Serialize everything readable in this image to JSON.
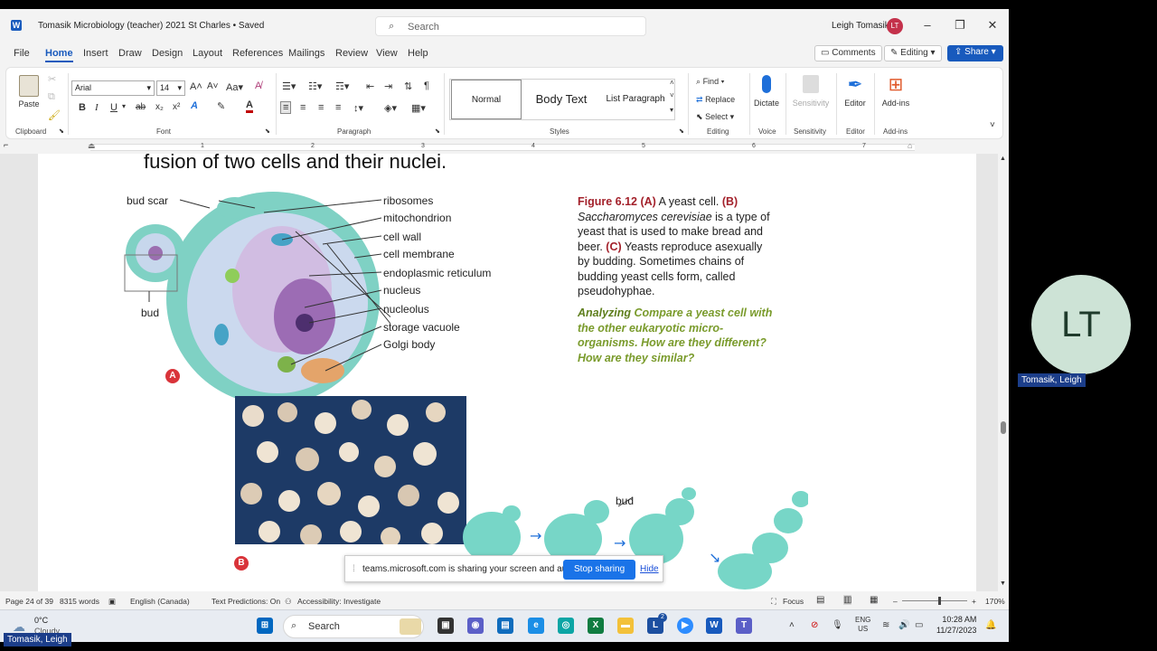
{
  "window": {
    "title": "Tomasik Microbiology (teacher) 2021 St Charles • Saved",
    "search_placeholder": "Search",
    "user_name": "Leigh Tomasik",
    "user_initials": "LT"
  },
  "menu": {
    "tabs": [
      "File",
      "Home",
      "Insert",
      "Draw",
      "Design",
      "Layout",
      "References",
      "Mailings",
      "Review",
      "View",
      "Help"
    ],
    "active_tab": "Home",
    "comments_label": "Comments",
    "editing_label": "Editing",
    "share_label": "Share"
  },
  "ribbon": {
    "clipboard": {
      "paste": "Paste",
      "group": "Clipboard"
    },
    "font": {
      "name": "Arial",
      "size": "14",
      "group": "Font"
    },
    "paragraph": {
      "group": "Paragraph"
    },
    "styles": {
      "items": [
        "Normal",
        "Body Text",
        "List Paragraph"
      ],
      "group": "Styles"
    },
    "editing": {
      "find": "Find",
      "replace": "Replace",
      "select": "Select",
      "group": "Editing"
    },
    "voice": {
      "dictate": "Dictate",
      "group": "Voice"
    },
    "sensitivity": {
      "label": "Sensitivity",
      "group": "Sensitivity"
    },
    "editor": {
      "label": "Editor",
      "group": "Editor"
    },
    "addins": {
      "label": "Add-ins",
      "group": "Add-ins"
    }
  },
  "ruler": {
    "numbers": [
      "1",
      "2",
      "3",
      "4",
      "5",
      "6",
      "7"
    ]
  },
  "document": {
    "heading": "fusion of two cells and their nuclei.",
    "diagram_labels": {
      "bud_scar": "bud scar",
      "bud": "bud",
      "ribosomes": "ribosomes",
      "mitochondrion": "mitochondrion",
      "cell_wall": "cell wall",
      "cell_membrane": "cell membrane",
      "er": "endoplasmic reticulum",
      "nucleus": "nucleus",
      "nucleolus": "nucleolus",
      "storage_vacuole": "storage vacuole",
      "golgi": "Golgi body",
      "bud_c": "bud",
      "badge_a": "A",
      "badge_b": "B"
    },
    "caption": {
      "fig": "Figure 6.12",
      "a_tag": "(A)",
      "a_text": " A yeast cell.",
      "b_tag": "(B)",
      "b_species": " Saccharomyces cerevisiae",
      "b_text": " is a type of yeast that is used to make bread and beer.",
      "c_tag": " (C)",
      "c_text": " Yeasts reproduce asexually by budding. Sometimes chains of budding yeast cells form, called pseudohyphae."
    },
    "analyzing": {
      "lead": "Analyzing",
      "text": "  Compare a yeast cell with the other eukaryotic micro-organisms. How are they different? How are they similar?"
    }
  },
  "sharing_banner": {
    "message": "teams.microsoft.com is sharing your screen and audio.",
    "stop": "Stop sharing",
    "hide": "Hide"
  },
  "status": {
    "page": "Page 24 of 39",
    "words": "8315 words",
    "language": "English (Canada)",
    "predictions": "Text Predictions: On",
    "accessibility": "Accessibility: Investigate",
    "focus": "Focus",
    "zoom": "170%"
  },
  "taskbar": {
    "temp": "0°C",
    "weather": "Cloudy",
    "search": "Search",
    "lang_top": "ENG",
    "lang_bottom": "US",
    "time": "10:28 AM",
    "date": "11/27/2023",
    "badge_count": "2"
  },
  "teams": {
    "participant_initials": "LT",
    "participant_name": "Tomasik, Leigh",
    "sharer_name": "Tomasik, Leigh"
  },
  "colors": {
    "word_blue": "#185abd",
    "caption_red": "#a3212b",
    "analyze_green": "#7a9b2c",
    "stop_blue": "#1a73e8"
  }
}
